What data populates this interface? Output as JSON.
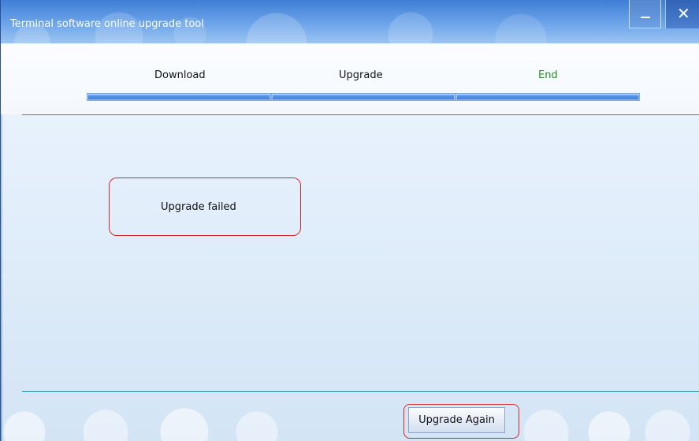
{
  "window": {
    "title": "Terminal software online upgrade tool",
    "controls": {
      "minimize_icon": "minimize-icon",
      "close_icon": "close-icon",
      "close_glyph": "✕"
    },
    "colors": {
      "titlebar": "#3f7ed5",
      "divider": "#2a8fa6",
      "highlight": "#d42626",
      "end_label": "#2a8a2a"
    }
  },
  "steps": {
    "download": "Download",
    "upgrade": "Upgrade",
    "end": "End",
    "progress": 1
  },
  "status": {
    "message": "Upgrade failed"
  },
  "actions": {
    "upgrade_again": "Upgrade Again"
  }
}
